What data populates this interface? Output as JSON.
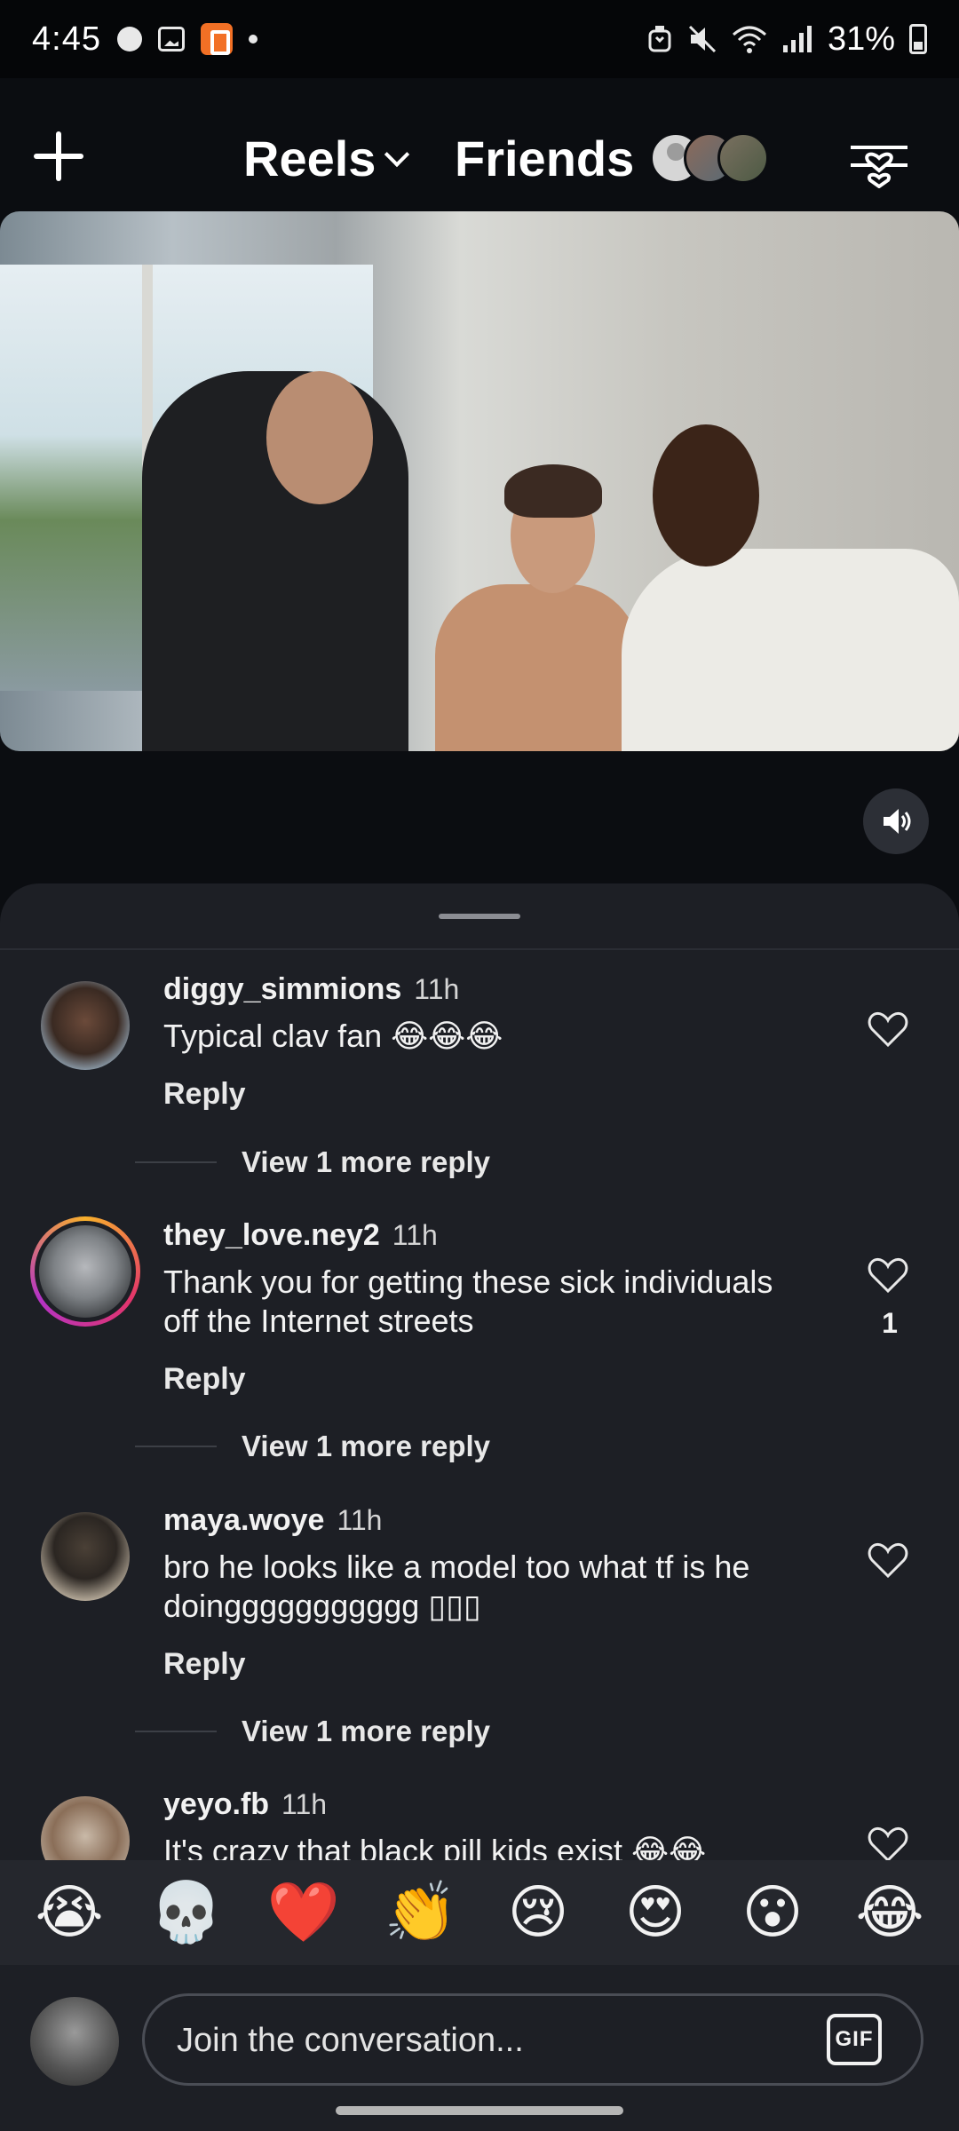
{
  "status_bar": {
    "time": "4:45",
    "battery": "31%",
    "icons": [
      "circle-notification-icon",
      "gallery-icon",
      "app-notification-icon",
      "dot-icon",
      "alarm-icon",
      "mute-icon",
      "wifi-icon",
      "signal-icon",
      "battery-icon"
    ]
  },
  "nav": {
    "reels_label": "Reels",
    "friends_label": "Friends",
    "icons": [
      "plus-icon",
      "chevron-down-icon",
      "filter-hearts-icon"
    ]
  },
  "video": {
    "sound_icon": "speaker-icon"
  },
  "comments": [
    {
      "username": "diggy_simmions",
      "time": "11h",
      "text": "Typical clav fan 😂😂😂",
      "reply_label": "Reply",
      "more_replies": "View 1 more reply",
      "likes": ""
    },
    {
      "username": "they_love.ney2",
      "time": "11h",
      "text": "Thank you for getting these sick individuals off the Internet streets",
      "reply_label": "Reply",
      "more_replies": "View 1 more reply",
      "likes": "1"
    },
    {
      "username": "maya.woye",
      "time": "11h",
      "text": "bro he looks like a model too what tf is he doinggggggggggg ▯▯▯",
      "reply_label": "Reply",
      "more_replies": "View 1 more reply",
      "likes": ""
    },
    {
      "username": "yeyo.fb",
      "time": "11h",
      "text": "It's crazy that black pill kids exist 😂😂",
      "likes": ""
    }
  ],
  "emoji_reactions": [
    "😭",
    "💀",
    "❤️",
    "👏",
    "😢",
    "😍",
    "😮",
    "😂"
  ],
  "composer": {
    "placeholder": "Join the conversation...",
    "gif_label": "GIF"
  },
  "colors": {
    "background": "#0b0d11",
    "sheet": "#1d1f25",
    "emoji_bar": "#25272d",
    "story_ring": "#e3356b"
  }
}
